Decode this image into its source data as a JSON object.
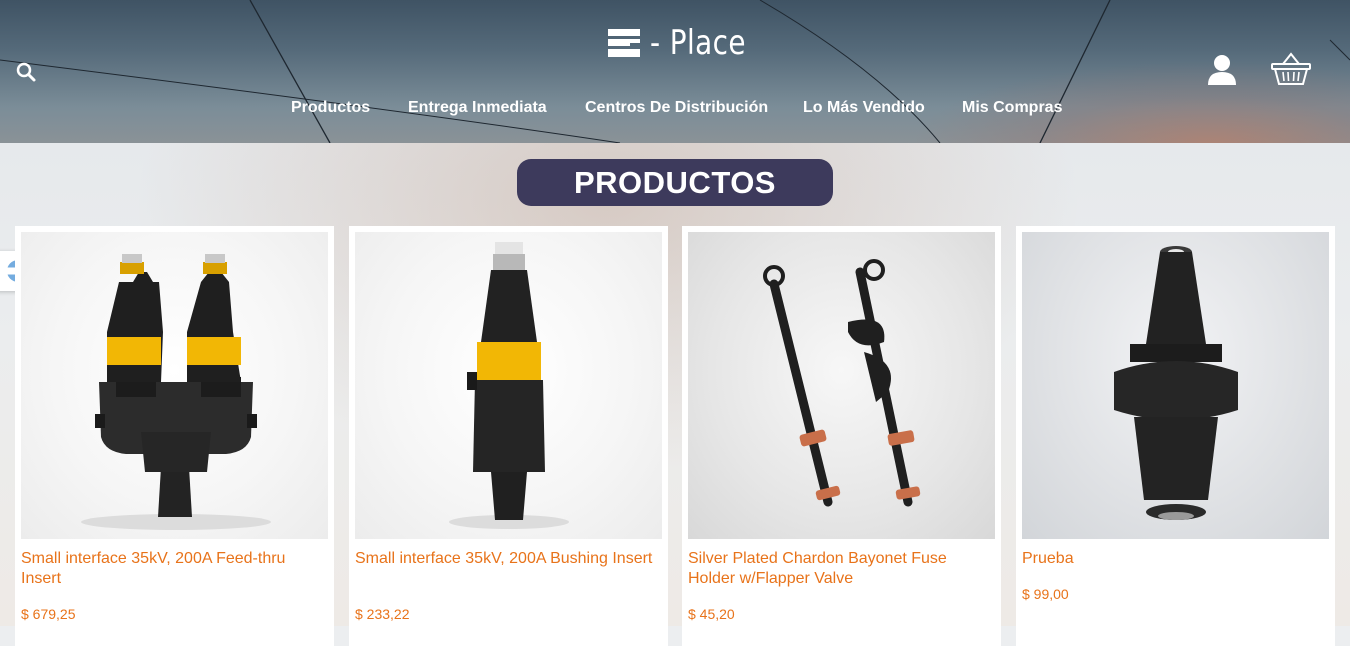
{
  "header": {
    "logo_text": "- Place",
    "nav": [
      {
        "label": "Productos"
      },
      {
        "label": "Entrega Inmediata"
      },
      {
        "label": "Centros De Distribución"
      },
      {
        "label": "Lo Más Vendido"
      },
      {
        "label": "Mis Compras"
      }
    ],
    "icons": {
      "search": "search-icon",
      "user": "user-icon",
      "cart": "basket-icon"
    }
  },
  "section_title": "PRODUCTOS",
  "country_flag": "argentina-flag-icon",
  "colors": {
    "accent_orange": "#e8731a",
    "pill_bg": "#3d3a5c",
    "product_yellow": "#f2b705"
  },
  "products": [
    {
      "title": "Small interface 35kV, 200A Feed-thru Insert",
      "price": "$ 679,25"
    },
    {
      "title": "Small interface 35kV, 200A Bushing Insert",
      "price": "$ 233,22"
    },
    {
      "title": "Silver Plated Chardon Bayonet Fuse Holder w/Flapper Valve",
      "price": "$ 45,20"
    },
    {
      "title": "Prueba",
      "price": "$ 99,00"
    }
  ]
}
